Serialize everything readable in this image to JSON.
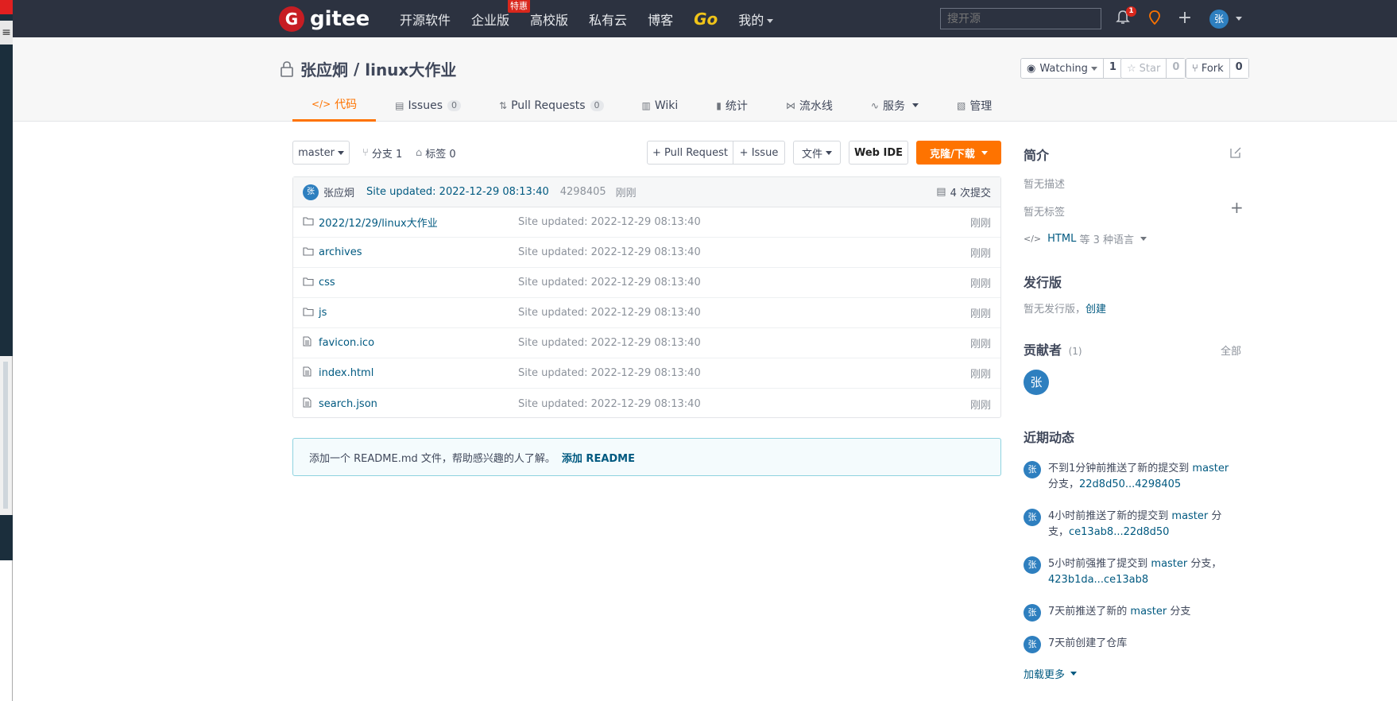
{
  "nav": {
    "logo_mark": "G",
    "logo_text": "gitee",
    "items": [
      "开源软件",
      "企业版",
      "高校版",
      "私有云",
      "博客",
      "Go",
      "我的"
    ],
    "special_badge": "特惠",
    "search_placeholder": "搜开源",
    "notification_count": "1",
    "avatar_initial": "张"
  },
  "repo": {
    "owner": "张应炯",
    "separator": " / ",
    "name": "linux大作业",
    "watch": {
      "label": "Watching",
      "count": "1"
    },
    "star": {
      "label": "Star",
      "count": "0"
    },
    "fork": {
      "label": "Fork",
      "count": "0"
    }
  },
  "tabs": [
    {
      "label": "代码",
      "icon": "code-icon",
      "glyph": "</>"
    },
    {
      "label": "Issues",
      "icon": "issues-icon",
      "glyph": "▤",
      "count": "0"
    },
    {
      "label": "Pull Requests",
      "icon": "pull-request-icon",
      "glyph": "⇅",
      "count": "0"
    },
    {
      "label": "Wiki",
      "icon": "wiki-icon",
      "glyph": "▥"
    },
    {
      "label": "统计",
      "icon": "stats-icon",
      "glyph": "▮"
    },
    {
      "label": "流水线",
      "icon": "pipeline-icon",
      "glyph": "⋈"
    },
    {
      "label": "服务",
      "icon": "service-icon",
      "glyph": "∿"
    },
    {
      "label": "管理",
      "icon": "manage-icon",
      "glyph": "▧"
    }
  ],
  "toolbar": {
    "branch": "master",
    "branches": "分支 1",
    "tags": "标签 0",
    "pull_request": "+ Pull Request",
    "issue": "+ Issue",
    "file": "文件",
    "web_ide": "Web IDE",
    "clone": "克隆/下载"
  },
  "commit": {
    "avatar": "张",
    "author": "张应炯",
    "message": "Site updated: 2022-12-29 08:13:40",
    "sha": "4298405",
    "time": "刚刚",
    "count": "4 次提交"
  },
  "files": [
    {
      "type": "folder",
      "name": "2022/12/29/linux大作业",
      "message": "Site updated: 2022-12-29 08:13:40",
      "time": "刚刚"
    },
    {
      "type": "folder",
      "name": "archives",
      "message": "Site updated: 2022-12-29 08:13:40",
      "time": "刚刚"
    },
    {
      "type": "folder",
      "name": "css",
      "message": "Site updated: 2022-12-29 08:13:40",
      "time": "刚刚"
    },
    {
      "type": "folder",
      "name": "js",
      "message": "Site updated: 2022-12-29 08:13:40",
      "time": "刚刚"
    },
    {
      "type": "file",
      "name": "favicon.ico",
      "message": "Site updated: 2022-12-29 08:13:40",
      "time": "刚刚"
    },
    {
      "type": "file",
      "name": "index.html",
      "message": "Site updated: 2022-12-29 08:13:40",
      "time": "刚刚"
    },
    {
      "type": "file",
      "name": "search.json",
      "message": "Site updated: 2022-12-29 08:13:40",
      "time": "刚刚"
    }
  ],
  "readme": {
    "hint": "添加一个 README.md 文件，帮助感兴趣的人了解。",
    "link": "添加 README"
  },
  "sidebar": {
    "intro_title": "简介",
    "no_desc": "暂无描述",
    "no_tags": "暂无标签",
    "lang_prefix": "HTML",
    "lang_suffix": " 等 3 种语言",
    "release_title": "发行版",
    "no_release": "暂无发行版，",
    "create": "创建",
    "contributors_title": "贡献者",
    "contributors_count": "(1)",
    "all": "全部",
    "contributor_initial": "张",
    "activity_title": "近期动态",
    "activities": [
      {
        "avatar": "张",
        "pre": "不到1分钟前推送了新的提交到 ",
        "branch": "master",
        "post": " 分支，",
        "ref": "22d8d50...4298405"
      },
      {
        "avatar": "张",
        "pre": "4小时前推送了新的提交到 ",
        "branch": "master",
        "post": " 分支，",
        "ref": "ce13ab8...22d8d50"
      },
      {
        "avatar": "张",
        "pre": "5小时前强推了提交到 ",
        "branch": "master",
        "post": " 分支，",
        "ref": "423b1da...ce13ab8"
      },
      {
        "avatar": "张",
        "pre": "7天前推送了新的 ",
        "branch": "master",
        "post": " 分支",
        "ref": ""
      },
      {
        "avatar": "张",
        "pre": "7天前创建了仓库",
        "branch": "",
        "post": "",
        "ref": ""
      }
    ],
    "load_more": "加载更多"
  },
  "colors": {
    "accent": "#fe7300",
    "nav_bg": "#2c3240",
    "link": "#005980",
    "avatar": "#2e7fbf",
    "brand": "#c71d23"
  }
}
